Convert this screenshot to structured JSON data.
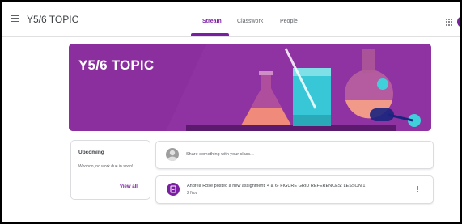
{
  "header": {
    "class_title": "Y5/6 TOPIC",
    "tabs": [
      {
        "label": "Stream"
      },
      {
        "label": "Classwork"
      },
      {
        "label": "People"
      }
    ],
    "active_tab": "Stream"
  },
  "banner": {
    "title": "Y5/6 TOPIC",
    "color": "#8b2f9e"
  },
  "upcoming": {
    "title": "Upcoming",
    "body": "Woohoo, no work due in soon!",
    "view_all": "View all"
  },
  "share": {
    "placeholder": "Share something with your class..."
  },
  "post": {
    "title": "Andrea Rose posted a new assignment: 4 & 6- FIGURE GRID REFERENCES: LESSON 1",
    "date": "2 Nov",
    "icon": "assignment-icon"
  },
  "colors": {
    "accent": "#7b1fa2"
  }
}
